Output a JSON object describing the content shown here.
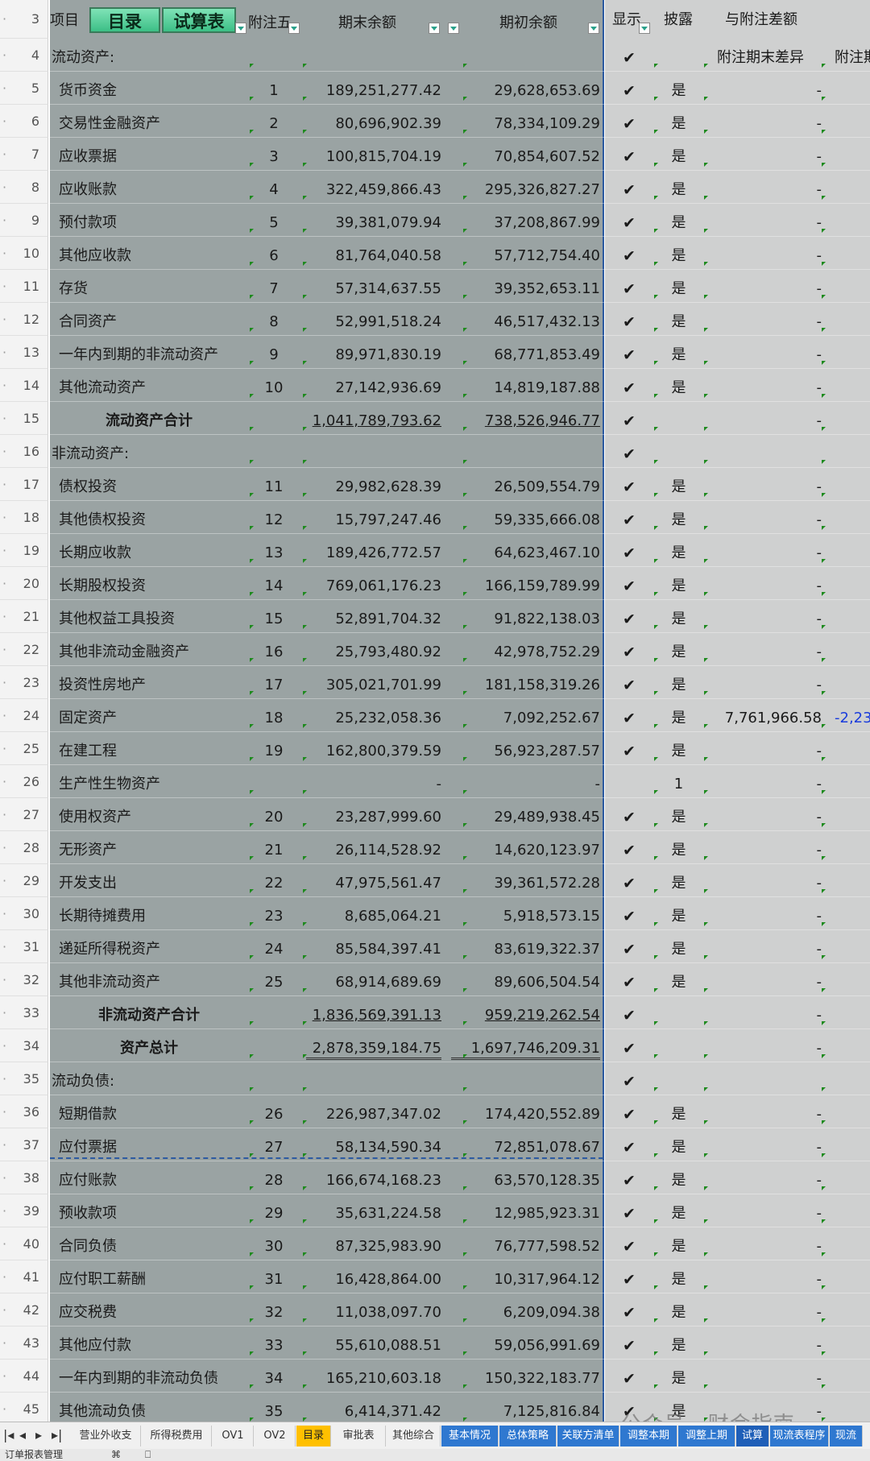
{
  "header": {
    "row_number": "3",
    "item": "项目",
    "btn_catalog": "目录",
    "btn_trial": "试算表",
    "note": "附注五",
    "end_balance": "期末余额",
    "begin_balance": "期初余额",
    "show": "显示",
    "disclose": "披露",
    "diff_group": "与附注差额",
    "diff_end": "附注期末差异",
    "diff_next": "附注期"
  },
  "rows": [
    {
      "n": "4",
      "label": "流动资产:",
      "type": "section",
      "show": "✔"
    },
    {
      "n": "5",
      "label": "货币资金",
      "note": "1",
      "end": "189,251,277.42",
      "beg": "29,628,653.69",
      "show": "✔",
      "disc": "是",
      "diff": "-"
    },
    {
      "n": "6",
      "label": "交易性金融资产",
      "note": "2",
      "end": "80,696,902.39",
      "beg": "78,334,109.29",
      "show": "✔",
      "disc": "是",
      "diff": "-"
    },
    {
      "n": "7",
      "label": "应收票据",
      "note": "3",
      "end": "100,815,704.19",
      "beg": "70,854,607.52",
      "show": "✔",
      "disc": "是",
      "diff": "-"
    },
    {
      "n": "8",
      "label": "应收账款",
      "note": "4",
      "end": "322,459,866.43",
      "beg": "295,326,827.27",
      "show": "✔",
      "disc": "是",
      "diff": "-"
    },
    {
      "n": "9",
      "label": "预付款项",
      "note": "5",
      "end": "39,381,079.94",
      "beg": "37,208,867.99",
      "show": "✔",
      "disc": "是",
      "diff": "-"
    },
    {
      "n": "10",
      "label": "其他应收款",
      "note": "6",
      "end": "81,764,040.58",
      "beg": "57,712,754.40",
      "show": "✔",
      "disc": "是",
      "diff": "-"
    },
    {
      "n": "11",
      "label": "存货",
      "note": "7",
      "end": "57,314,637.55",
      "beg": "39,352,653.11",
      "show": "✔",
      "disc": "是",
      "diff": "-"
    },
    {
      "n": "12",
      "label": "合同资产",
      "note": "8",
      "end": "52,991,518.24",
      "beg": "46,517,432.13",
      "show": "✔",
      "disc": "是",
      "diff": "-"
    },
    {
      "n": "13",
      "label": "一年内到期的非流动资产",
      "note": "9",
      "end": "89,971,830.19",
      "beg": "68,771,853.49",
      "show": "✔",
      "disc": "是",
      "diff": "-"
    },
    {
      "n": "14",
      "label": "其他流动资产",
      "note": "10",
      "end": "27,142,936.69",
      "beg": "14,819,187.88",
      "show": "✔",
      "disc": "是",
      "diff": "-"
    },
    {
      "n": "15",
      "label": "流动资产合计",
      "type": "total",
      "end": "1,041,789,793.62",
      "beg": "738,526,946.77",
      "show": "✔",
      "diff": "-"
    },
    {
      "n": "16",
      "label": "非流动资产:",
      "type": "section",
      "show": "✔"
    },
    {
      "n": "17",
      "label": "债权投资",
      "note": "11",
      "end": "29,982,628.39",
      "beg": "26,509,554.79",
      "show": "✔",
      "disc": "是",
      "diff": "-"
    },
    {
      "n": "18",
      "label": "其他债权投资",
      "note": "12",
      "end": "15,797,247.46",
      "beg": "59,335,666.08",
      "show": "✔",
      "disc": "是",
      "diff": "-"
    },
    {
      "n": "19",
      "label": "长期应收款",
      "note": "13",
      "end": "189,426,772.57",
      "beg": "64,623,467.10",
      "show": "✔",
      "disc": "是",
      "diff": "-"
    },
    {
      "n": "20",
      "label": "长期股权投资",
      "note": "14",
      "end": "769,061,176.23",
      "beg": "166,159,789.99",
      "show": "✔",
      "disc": "是",
      "diff": "-"
    },
    {
      "n": "21",
      "label": "其他权益工具投资",
      "note": "15",
      "end": "52,891,704.32",
      "beg": "91,822,138.03",
      "show": "✔",
      "disc": "是",
      "diff": "-"
    },
    {
      "n": "22",
      "label": "其他非流动金融资产",
      "note": "16",
      "end": "25,793,480.92",
      "beg": "42,978,752.29",
      "show": "✔",
      "disc": "是",
      "diff": "-"
    },
    {
      "n": "23",
      "label": "投资性房地产",
      "note": "17",
      "end": "305,021,701.99",
      "beg": "181,158,319.26",
      "show": "✔",
      "disc": "是",
      "diff": "-"
    },
    {
      "n": "24",
      "label": "固定资产",
      "note": "18",
      "end": "25,232,058.36",
      "beg": "7,092,252.67",
      "show": "✔",
      "disc": "是",
      "diff": "7,761,966.58",
      "extra": "-2,23"
    },
    {
      "n": "25",
      "label": "在建工程",
      "note": "19",
      "end": "162,800,379.59",
      "beg": "56,923,287.57",
      "show": "✔",
      "disc": "是",
      "diff": "-"
    },
    {
      "n": "26",
      "label": "生产性生物资产",
      "end": "-",
      "beg": "-",
      "disc": "1",
      "diff": "-"
    },
    {
      "n": "27",
      "label": "使用权资产",
      "note": "20",
      "end": "23,287,999.60",
      "beg": "29,489,938.45",
      "show": "✔",
      "disc": "是",
      "diff": "-"
    },
    {
      "n": "28",
      "label": "无形资产",
      "note": "21",
      "end": "26,114,528.92",
      "beg": "14,620,123.97",
      "show": "✔",
      "disc": "是",
      "diff": "-"
    },
    {
      "n": "29",
      "label": "开发支出",
      "note": "22",
      "end": "47,975,561.47",
      "beg": "39,361,572.28",
      "show": "✔",
      "disc": "是",
      "diff": "-"
    },
    {
      "n": "30",
      "label": "长期待摊费用",
      "note": "23",
      "end": "8,685,064.21",
      "beg": "5,918,573.15",
      "show": "✔",
      "disc": "是",
      "diff": "-"
    },
    {
      "n": "31",
      "label": "递延所得税资产",
      "note": "24",
      "end": "85,584,397.41",
      "beg": "83,619,322.37",
      "show": "✔",
      "disc": "是",
      "diff": "-"
    },
    {
      "n": "32",
      "label": "其他非流动资产",
      "note": "25",
      "end": "68,914,689.69",
      "beg": "89,606,504.54",
      "show": "✔",
      "disc": "是",
      "diff": "-"
    },
    {
      "n": "33",
      "label": "非流动资产合计",
      "type": "total",
      "end": "1,836,569,391.13",
      "beg": "959,219,262.54",
      "show": "✔",
      "diff": "-"
    },
    {
      "n": "34",
      "label": "资产总计",
      "type": "total2",
      "end": "2,878,359,184.75",
      "beg": "1,697,746,209.31",
      "show": "✔",
      "diff": "-"
    },
    {
      "n": "35",
      "label": "流动负债:",
      "type": "section",
      "show": "✔"
    },
    {
      "n": "36",
      "label": "短期借款",
      "note": "26",
      "end": "226,987,347.02",
      "beg": "174,420,552.89",
      "show": "✔",
      "disc": "是",
      "diff": "-"
    },
    {
      "n": "37",
      "label": "应付票据",
      "note": "27",
      "end": "58,134,590.34",
      "beg": "72,851,078.67",
      "show": "✔",
      "disc": "是",
      "diff": "-"
    },
    {
      "n": "38",
      "label": "应付账款",
      "note": "28",
      "end": "166,674,168.23",
      "beg": "63,570,128.35",
      "show": "✔",
      "disc": "是",
      "diff": "-"
    },
    {
      "n": "39",
      "label": "预收款项",
      "note": "29",
      "end": "35,631,224.58",
      "beg": "12,985,923.31",
      "show": "✔",
      "disc": "是",
      "diff": "-"
    },
    {
      "n": "40",
      "label": "合同负债",
      "note": "30",
      "end": "87,325,983.90",
      "beg": "76,777,598.52",
      "show": "✔",
      "disc": "是",
      "diff": "-"
    },
    {
      "n": "41",
      "label": "应付职工薪酬",
      "note": "31",
      "end": "16,428,864.00",
      "beg": "10,317,964.12",
      "show": "✔",
      "disc": "是",
      "diff": "-"
    },
    {
      "n": "42",
      "label": "应交税费",
      "note": "32",
      "end": "11,038,097.70",
      "beg": "6,209,094.38",
      "show": "✔",
      "disc": "是",
      "diff": "-"
    },
    {
      "n": "43",
      "label": "其他应付款",
      "note": "33",
      "end": "55,610,088.51",
      "beg": "59,056,991.69",
      "show": "✔",
      "disc": "是",
      "diff": "-"
    },
    {
      "n": "44",
      "label": "一年内到期的非流动负债",
      "note": "34",
      "end": "165,210,603.18",
      "beg": "150,322,183.77",
      "show": "✔",
      "disc": "是",
      "diff": "-"
    },
    {
      "n": "45",
      "label": "其他流动负债",
      "note": "35",
      "end": "6,414,371.42",
      "beg": "7,125,816.84",
      "show": "✔",
      "disc": "是",
      "diff": "-"
    }
  ],
  "tabs": [
    {
      "label": "营业外收支",
      "style": "plain"
    },
    {
      "label": "所得税费用",
      "style": "plain"
    },
    {
      "label": "OV1",
      "style": "plain"
    },
    {
      "label": "OV2",
      "style": "plain"
    },
    {
      "label": "目录",
      "style": "yellow"
    },
    {
      "label": "审批表",
      "style": "plain"
    },
    {
      "label": "其他综合",
      "style": "plain"
    },
    {
      "label": "基本情况",
      "style": "blue"
    },
    {
      "label": "总体策略",
      "style": "blue"
    },
    {
      "label": "关联方清单",
      "style": "blue"
    },
    {
      "label": "调整本期",
      "style": "blue"
    },
    {
      "label": "调整上期",
      "style": "blue"
    },
    {
      "label": "试算",
      "style": "dark"
    },
    {
      "label": "现流表程序",
      "style": "blue"
    },
    {
      "label": "现流",
      "style": "blue"
    }
  ],
  "nav": [
    "|◂",
    "◂",
    "▸",
    "▸|"
  ],
  "statusbar": {
    "left": "订单报表管理",
    "mid": "⌘",
    "right": "⎕"
  },
  "watermark": "公众号 · 财会指南",
  "colors": {
    "selection": "#9aa3a3",
    "accent": "#2c5aa0",
    "tab_yellow": "#ffc000",
    "tab_blue": "#2f78d0"
  }
}
